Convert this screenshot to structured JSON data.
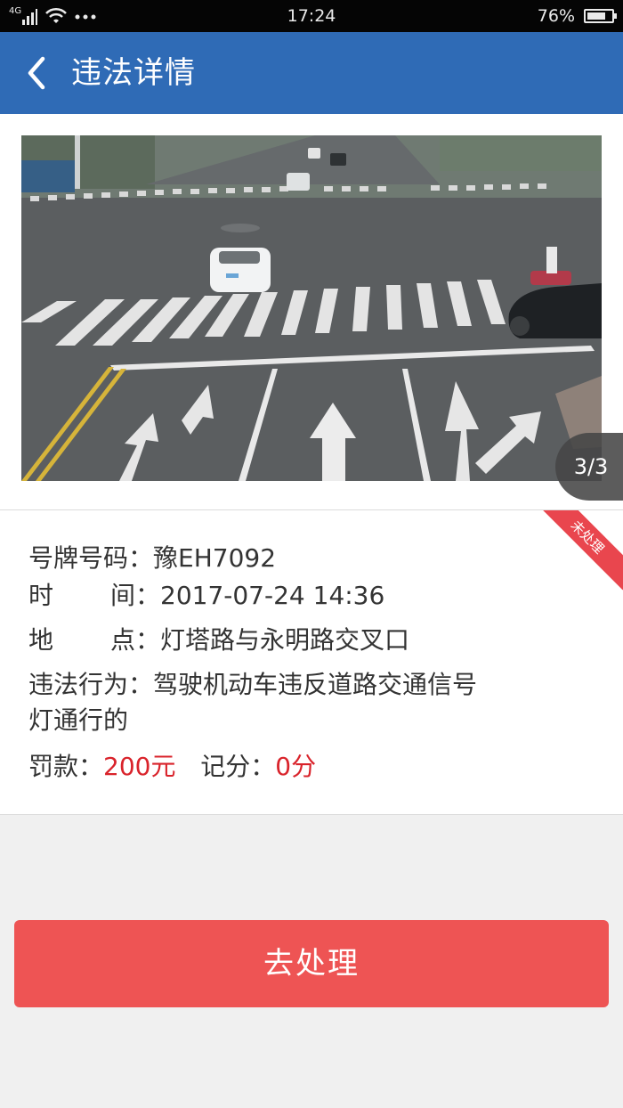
{
  "status_bar": {
    "network": "4G",
    "time": "17:24",
    "battery": "76%",
    "battery_level": 0.76
  },
  "header": {
    "title": "违法详情",
    "back_icon": "back-chevron-icon"
  },
  "photo": {
    "counter": "3/3"
  },
  "violation": {
    "status_ribbon": "未处理",
    "plate_label": "号牌号码：",
    "plate_value": "豫EH7092",
    "time_label_a": "时",
    "time_label_b": "间：",
    "time_value": "2017-07-24 14:36",
    "location_label_a": "地",
    "location_label_b": "点：",
    "location_value": "灯塔路与永明路交叉口",
    "behavior_label": "违法行为：",
    "behavior_value_line1": "驾驶机动车违反道路交通信号",
    "behavior_value_line2": "灯通行的",
    "fine_label": "罚款：",
    "fine_value": "200元",
    "points_label": "记分：",
    "points_value": "0分"
  },
  "action": {
    "button_label": "去处理"
  },
  "colors": {
    "header_bg": "#2f6bb6",
    "button_bg": "#ee5454",
    "accent_red": "#d9232b",
    "ribbon_bg": "#e9464e"
  }
}
